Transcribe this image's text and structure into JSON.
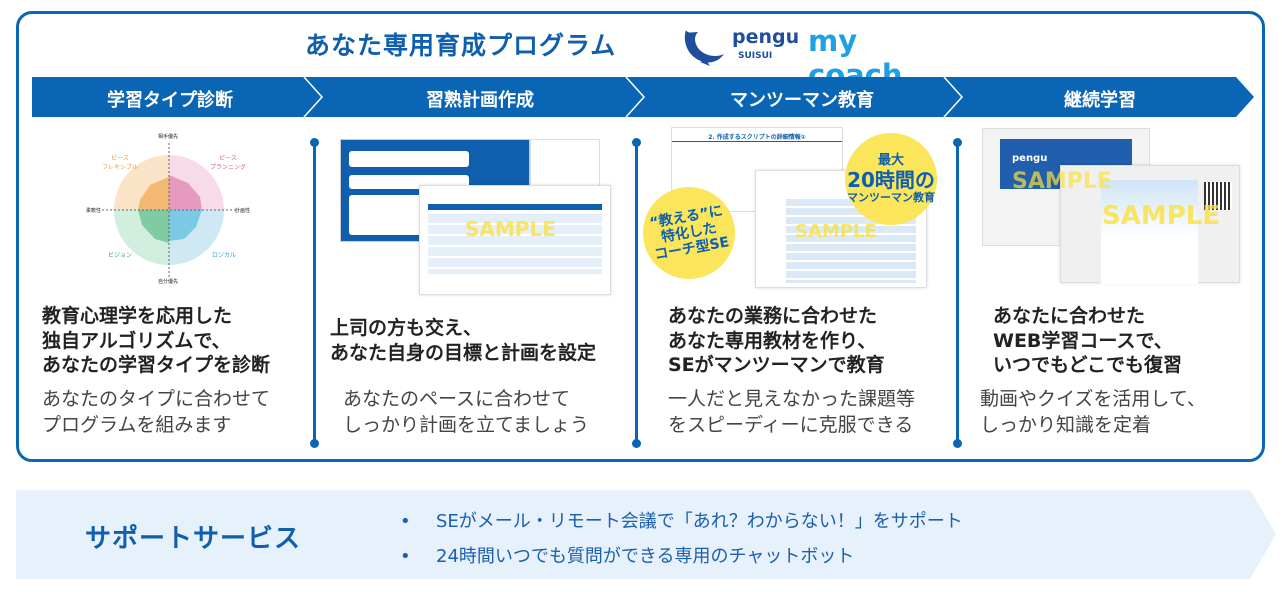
{
  "header": {
    "title": "あなた専用育成プログラム",
    "logo": {
      "brand": "pengu",
      "sub": "SUISUI",
      "product": "my coach"
    }
  },
  "colors": {
    "primary": "#0a66b5",
    "accent": "#1fa0e3",
    "badge": "#fbe55a",
    "band": "#e6f1fb"
  },
  "steps": [
    {
      "label": "学習タイプ診断",
      "headline": [
        "教育心理学を応用した",
        "独自アルゴリズムで、",
        "あなたの学習タイプを診断"
      ],
      "description": [
        "あなたのタイプに合わせて",
        "プログラムを組みます"
      ],
      "image": {
        "axes": [
          "相手優先",
          "計画性",
          "自分優先",
          "柔軟性"
        ],
        "types": [
          "ピース\nフレキシブル",
          "ピース\nプランニング",
          "ビジョン",
          "ロジカル"
        ]
      }
    },
    {
      "label": "習熟計画作成",
      "headline": [
        "上司の方も交え、",
        "あなた自身の目標と計画を設定"
      ],
      "description": [
        "あなたのペースに合わせて",
        "しっかり計画を立てましょう"
      ],
      "image": {
        "watermark": "SAMPLE"
      }
    },
    {
      "label": "マンツーマン教育",
      "headline": [
        "あなたの業務に合わせた",
        "あなた専用教材を作り、",
        "SEがマンツーマンで教育"
      ],
      "description": [
        "一人だと見えなかった課題等",
        "をスピーディーに克服できる"
      ],
      "image": {
        "watermark": "SAMPLE",
        "doc_title": "2. 作成するスクリプトの詳細情報①",
        "badge_left": [
          "“教える”に",
          "特化した",
          "コーチ型SE"
        ],
        "badge_right": [
          "最大",
          "20時間の",
          "マンツーマン教育"
        ]
      }
    },
    {
      "label": "継続学習",
      "headline": [
        "あなたに合わせた",
        "WEB学習コースで、",
        "いつでもどこでも復習"
      ],
      "description": [
        "動画やクイズを活用して、",
        "しっかり知識を定着"
      ],
      "image": {
        "watermark": "SAMPLE",
        "brand": "pengu"
      }
    }
  ],
  "support": {
    "title": "サポートサービス",
    "bullets": [
      "SEがメール・リモート会議で「あれ？わからない！」をサポート",
      "24時間いつでも質問ができる専用のチャットボット"
    ],
    "bullet_symbol": "•"
  }
}
